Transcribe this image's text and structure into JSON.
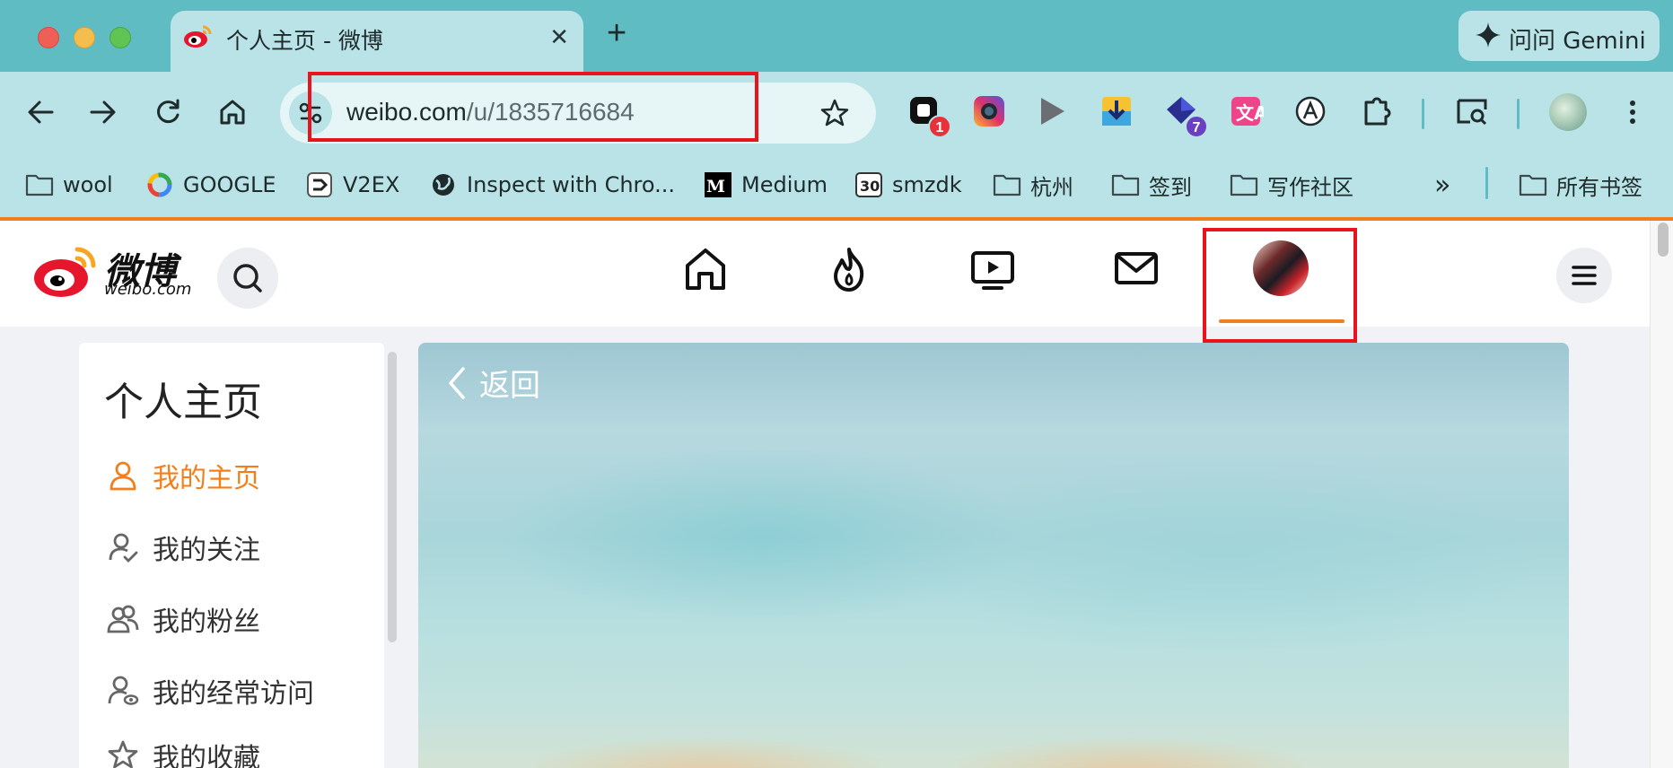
{
  "browser": {
    "tab": {
      "title": "个人主页 - 微博"
    },
    "gemini_label": "问问 Gemini",
    "url": {
      "host": "weibo.com",
      "path": "/u/1835716684"
    },
    "extensions": [
      {
        "icon": "ext-app-icon",
        "badge": "1",
        "badge_color": "#e8313b"
      },
      {
        "icon": "ext-camera-icon"
      },
      {
        "icon": "ext-play-icon"
      },
      {
        "icon": "ext-download-icon"
      },
      {
        "icon": "ext-diamond-icon",
        "badge": "7",
        "badge_color": "#6a3fc4"
      },
      {
        "icon": "ext-translate-icon"
      },
      {
        "icon": "ext-a-circle-icon"
      },
      {
        "icon": "puzzle-icon"
      },
      {
        "icon": "tab-search-icon"
      },
      {
        "icon": "profile-avatar"
      },
      {
        "icon": "kebab-menu-icon"
      }
    ],
    "bookmarks": [
      {
        "label": "wool",
        "icon": "folder-icon"
      },
      {
        "label": "GOOGLE",
        "icon": "google-icon"
      },
      {
        "label": "V2EX",
        "icon": "v2ex-icon"
      },
      {
        "label": "Inspect with Chro...",
        "icon": "globe-icon"
      },
      {
        "label": "Medium",
        "icon": "medium-icon"
      },
      {
        "label": "smzdk",
        "icon": "calendar-30-icon"
      },
      {
        "label": "杭州",
        "icon": "folder-icon"
      },
      {
        "label": "签到",
        "icon": "folder-icon"
      },
      {
        "label": "写作社区",
        "icon": "folder-icon"
      }
    ],
    "overflow_label": "»",
    "all_bookmarks_label": "所有书签"
  },
  "weibo": {
    "logo_text": "微博",
    "logo_sub": "weibo.com",
    "nav": [
      "home-icon",
      "hot-fire-icon",
      "video-icon",
      "message-icon",
      "user-avatar"
    ],
    "side": {
      "title": "个人主页",
      "items": [
        {
          "label": "我的主页",
          "icon": "user-icon",
          "active": true
        },
        {
          "label": "我的关注",
          "icon": "user-check-icon"
        },
        {
          "label": "我的粉丝",
          "icon": "users-icon"
        },
        {
          "label": "我的经常访问",
          "icon": "user-eye-icon"
        },
        {
          "label": "我的收藏",
          "icon": "star-icon"
        }
      ]
    },
    "back_label": "返回",
    "accent": "#f27f1a",
    "highlight_color": "#e8131d"
  }
}
